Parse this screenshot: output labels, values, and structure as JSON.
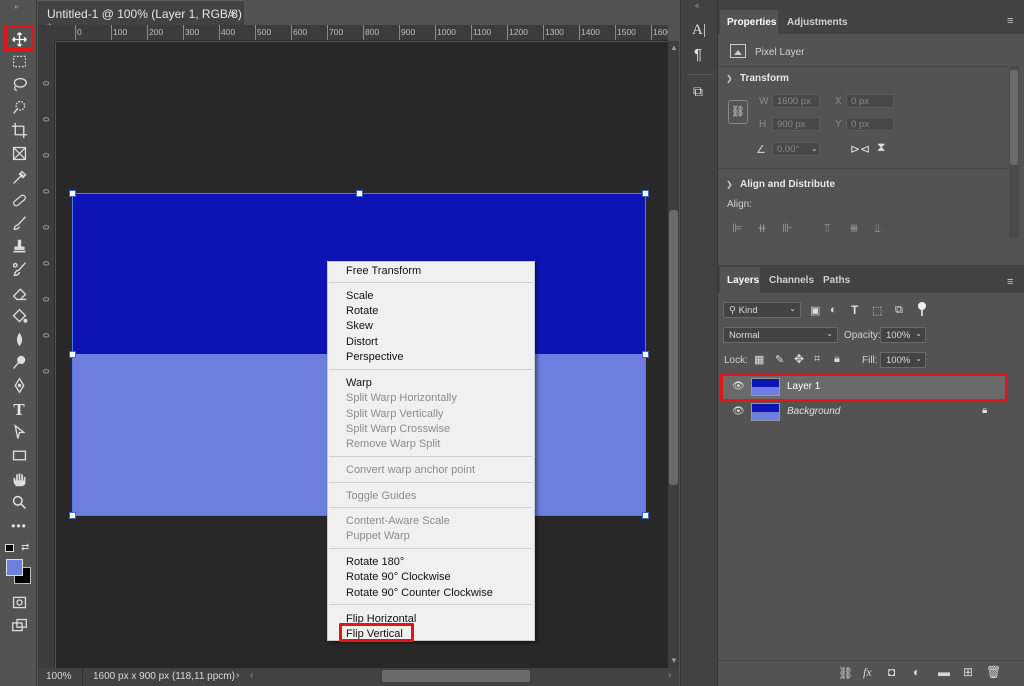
{
  "document": {
    "tab_title": "Untitled-1 @ 100% (Layer 1, RGB/8) *",
    "close_glyph": "×",
    "zoom": "100%",
    "status_info": "1600 px x 900 px (118,11 ppcm)",
    "ruler_top": [
      "0",
      "100",
      "200",
      "300",
      "400",
      "500",
      "600",
      "700",
      "800",
      "900",
      "1000",
      "1100",
      "1200",
      "1300",
      "1400",
      "1500",
      "1600"
    ],
    "ruler_left": [
      "0",
      "0",
      "0",
      "0",
      "0",
      "0",
      "0",
      "0",
      "0"
    ],
    "colors": {
      "top_band": "#0e13b5",
      "bottom_band": "#6f7fe0",
      "canvas_bg": "#282828"
    }
  },
  "tools": [
    "move-tool",
    "marquee-tool",
    "lasso-tool",
    "quick-select-tool",
    "crop-tool",
    "frame-tool",
    "eyedropper-tool",
    "healing-brush-tool",
    "brush-tool",
    "clone-stamp-tool",
    "history-brush-tool",
    "eraser-tool",
    "paint-bucket-tool",
    "blur-tool",
    "dodge-tool",
    "pen-tool",
    "type-tool",
    "path-select-tool",
    "rectangle-tool",
    "hand-tool",
    "zoom-tool",
    "more-tools"
  ],
  "context_menu": {
    "items": [
      {
        "label": "Free Transform",
        "enabled": true
      },
      {
        "label": "Scale",
        "enabled": true
      },
      {
        "label": "Rotate",
        "enabled": true
      },
      {
        "label": "Skew",
        "enabled": true
      },
      {
        "label": "Distort",
        "enabled": true
      },
      {
        "label": "Perspective",
        "enabled": true
      },
      {
        "label": "Warp",
        "enabled": true
      },
      {
        "label": "Split Warp Horizontally",
        "enabled": false
      },
      {
        "label": "Split Warp Vertically",
        "enabled": false
      },
      {
        "label": "Split Warp Crosswise",
        "enabled": false
      },
      {
        "label": "Remove Warp Split",
        "enabled": false
      },
      {
        "label": "Convert warp anchor point",
        "enabled": false
      },
      {
        "label": "Toggle Guides",
        "enabled": false
      },
      {
        "label": "Content-Aware Scale",
        "enabled": false
      },
      {
        "label": "Puppet Warp",
        "enabled": false
      },
      {
        "label": "Rotate 180°",
        "enabled": true
      },
      {
        "label": "Rotate 90° Clockwise",
        "enabled": true
      },
      {
        "label": "Rotate 90° Counter Clockwise",
        "enabled": true
      },
      {
        "label": "Flip Horizontal",
        "enabled": true
      },
      {
        "label": "Flip Vertical",
        "enabled": true
      }
    ],
    "highlighted": "Flip Vertical"
  },
  "properties": {
    "tabs": [
      "Properties",
      "Adjustments"
    ],
    "layer_kind": "Pixel Layer",
    "transform_title": "Transform",
    "w_label": "W",
    "w_value": "1600 px",
    "h_label": "H",
    "h_value": "900 px",
    "x_label": "X",
    "x_value": "0 px",
    "y_label": "Y",
    "y_value": "0 px",
    "angle_value": "0.00°",
    "align_title": "Align and Distribute",
    "align_label": "Align:"
  },
  "layers_panel": {
    "tabs": [
      "Layers",
      "Channels",
      "Paths"
    ],
    "filter": "Kind",
    "blend_mode": "Normal",
    "opacity_label": "Opacity:",
    "opacity_value": "100%",
    "lock_label": "Lock:",
    "fill_label": "Fill:",
    "fill_value": "100%",
    "layers": [
      {
        "name": "Layer 1",
        "selected": true,
        "locked": false
      },
      {
        "name": "Background",
        "selected": false,
        "locked": true
      }
    ]
  }
}
